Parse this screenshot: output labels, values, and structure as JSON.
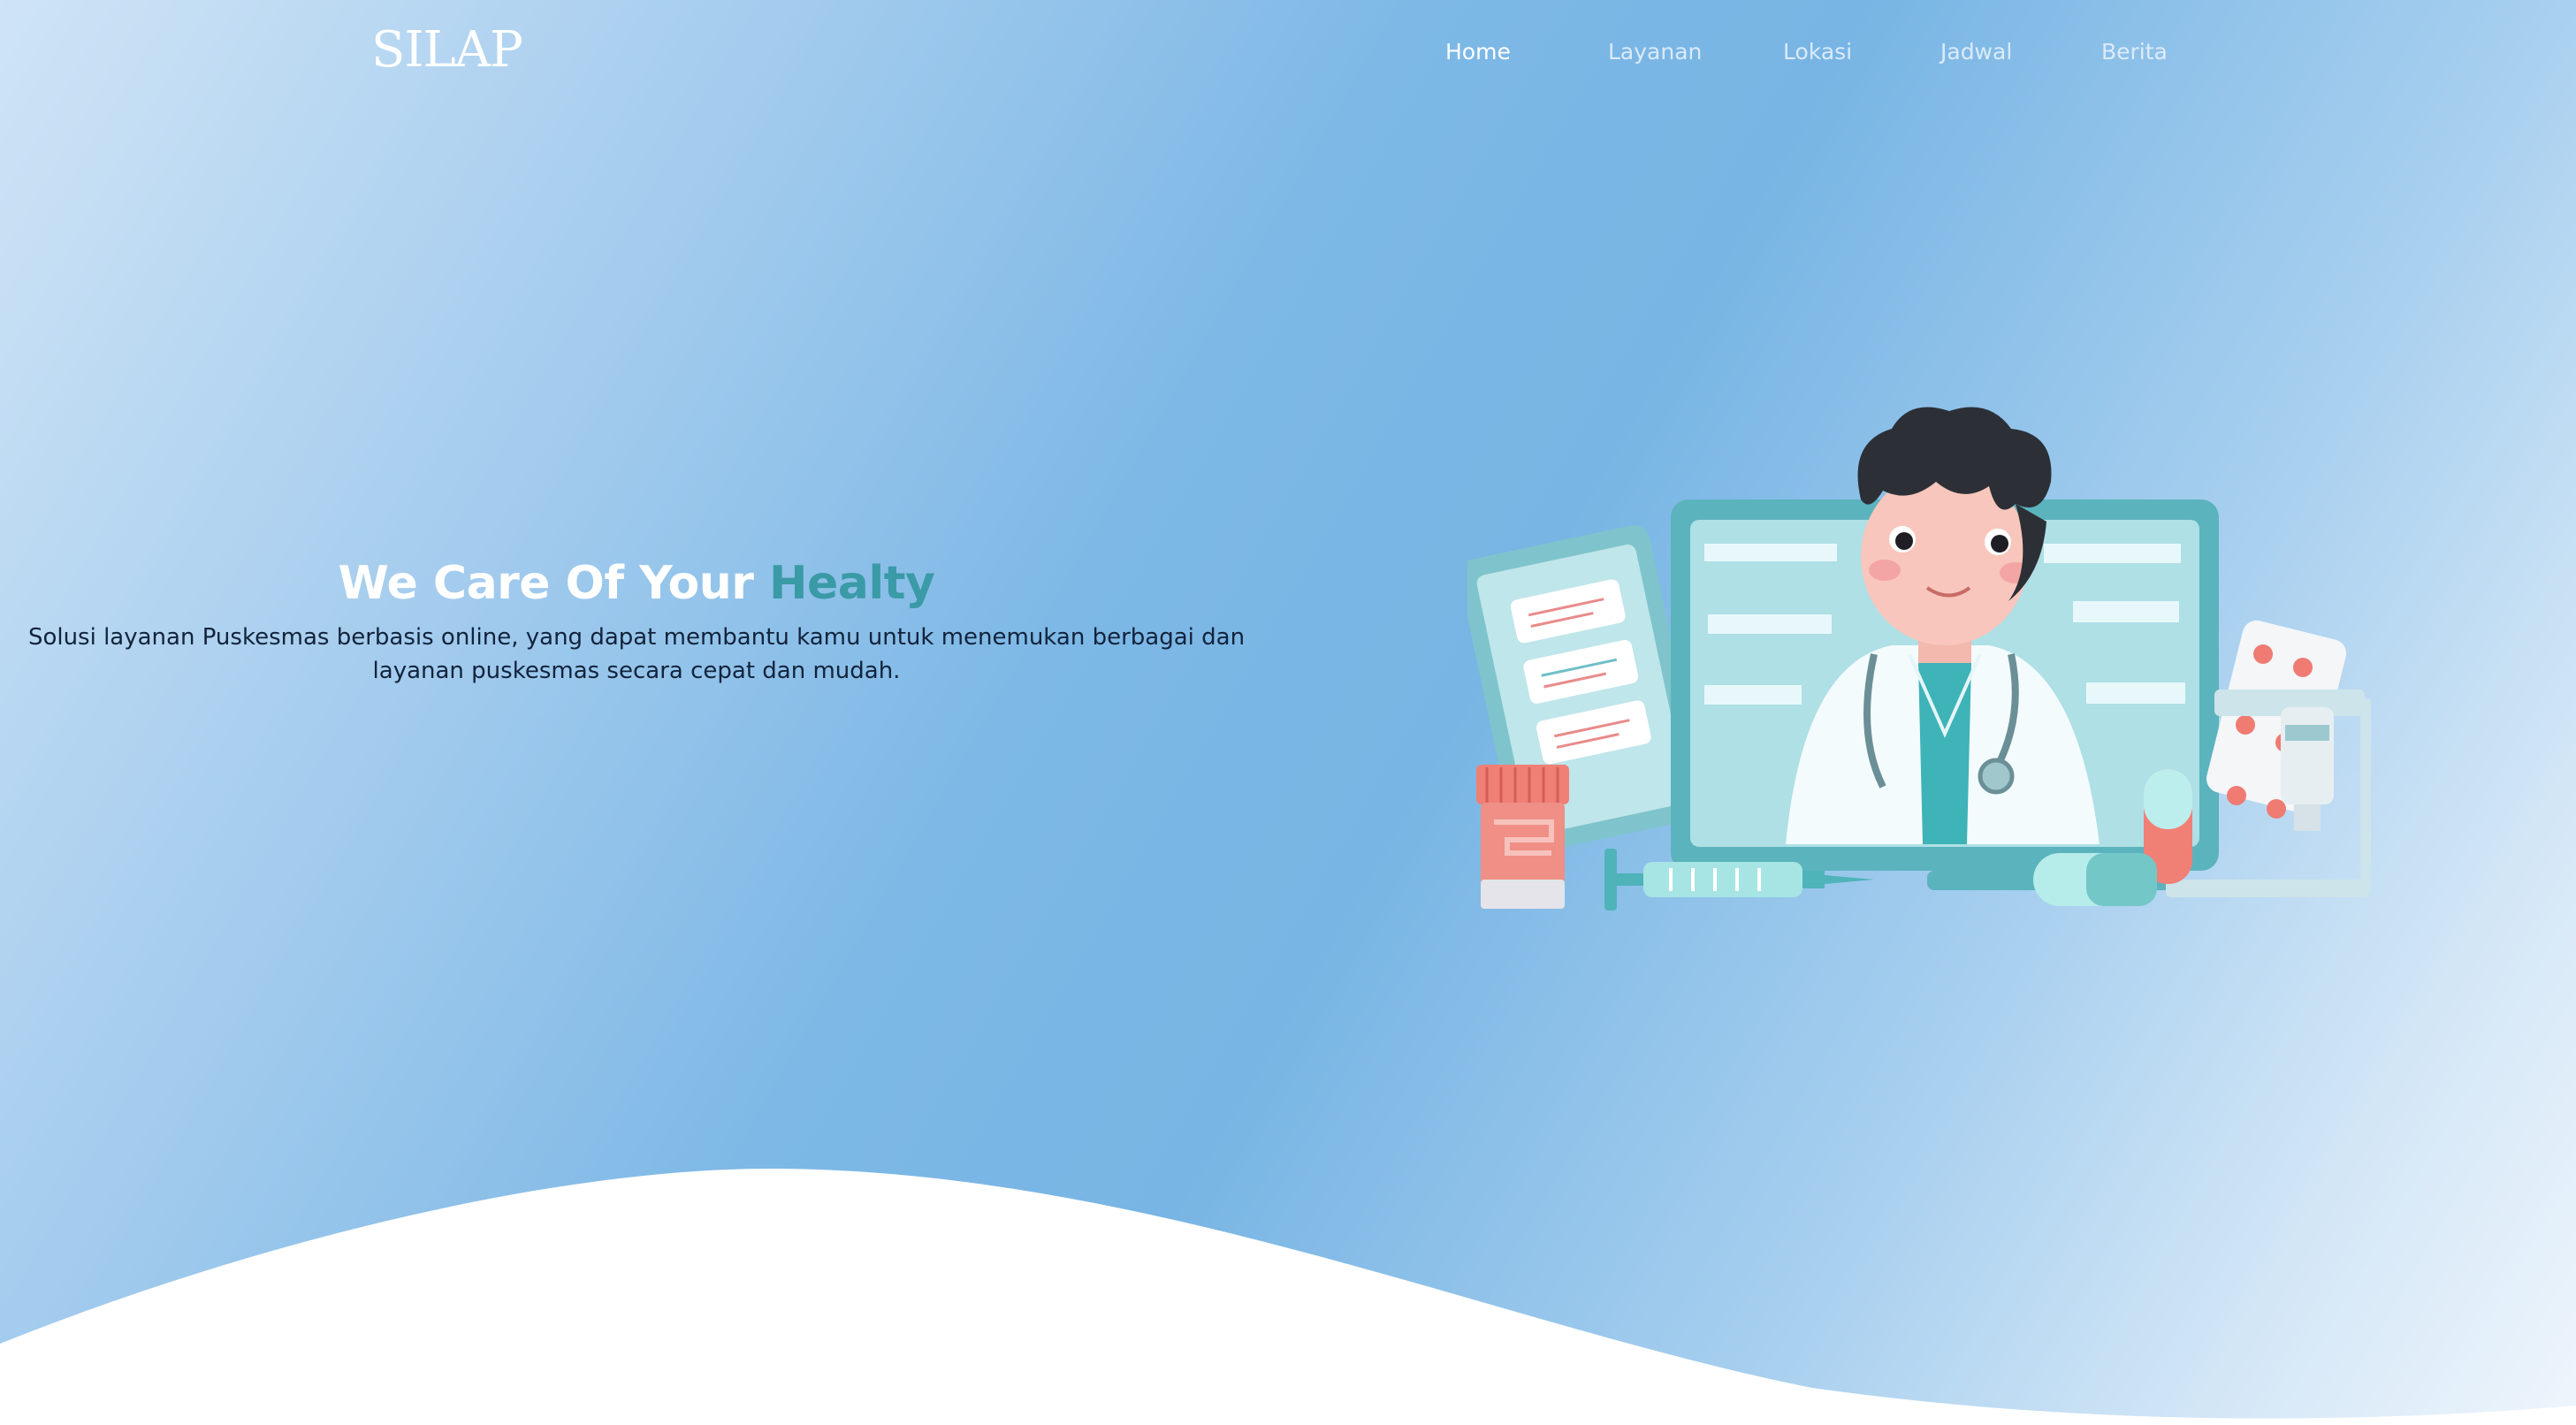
{
  "brand": {
    "logo_text": "SILAP"
  },
  "nav": {
    "items": [
      {
        "label": "Home",
        "active": true
      },
      {
        "label": "Layanan",
        "active": false
      },
      {
        "label": "Lokasi",
        "active": false
      },
      {
        "label": "Jadwal",
        "active": false
      },
      {
        "label": "Berita",
        "active": false
      }
    ]
  },
  "hero": {
    "title_main": "We Care Of Your",
    "title_accent": "Healty",
    "subtitle": "Solusi layanan Puskesmas berbasis online, yang dapat membantu kamu untuk menemukan berbagai dan layanan puskesmas secara cepat dan mudah."
  },
  "illustration": {
    "icon": "doctor-telemedicine-illustration"
  },
  "colors": {
    "accent": "#3a9aa6",
    "background_mid": "#7db8e6",
    "background_light": "#d6e8f7",
    "wave": "#ffffff"
  }
}
